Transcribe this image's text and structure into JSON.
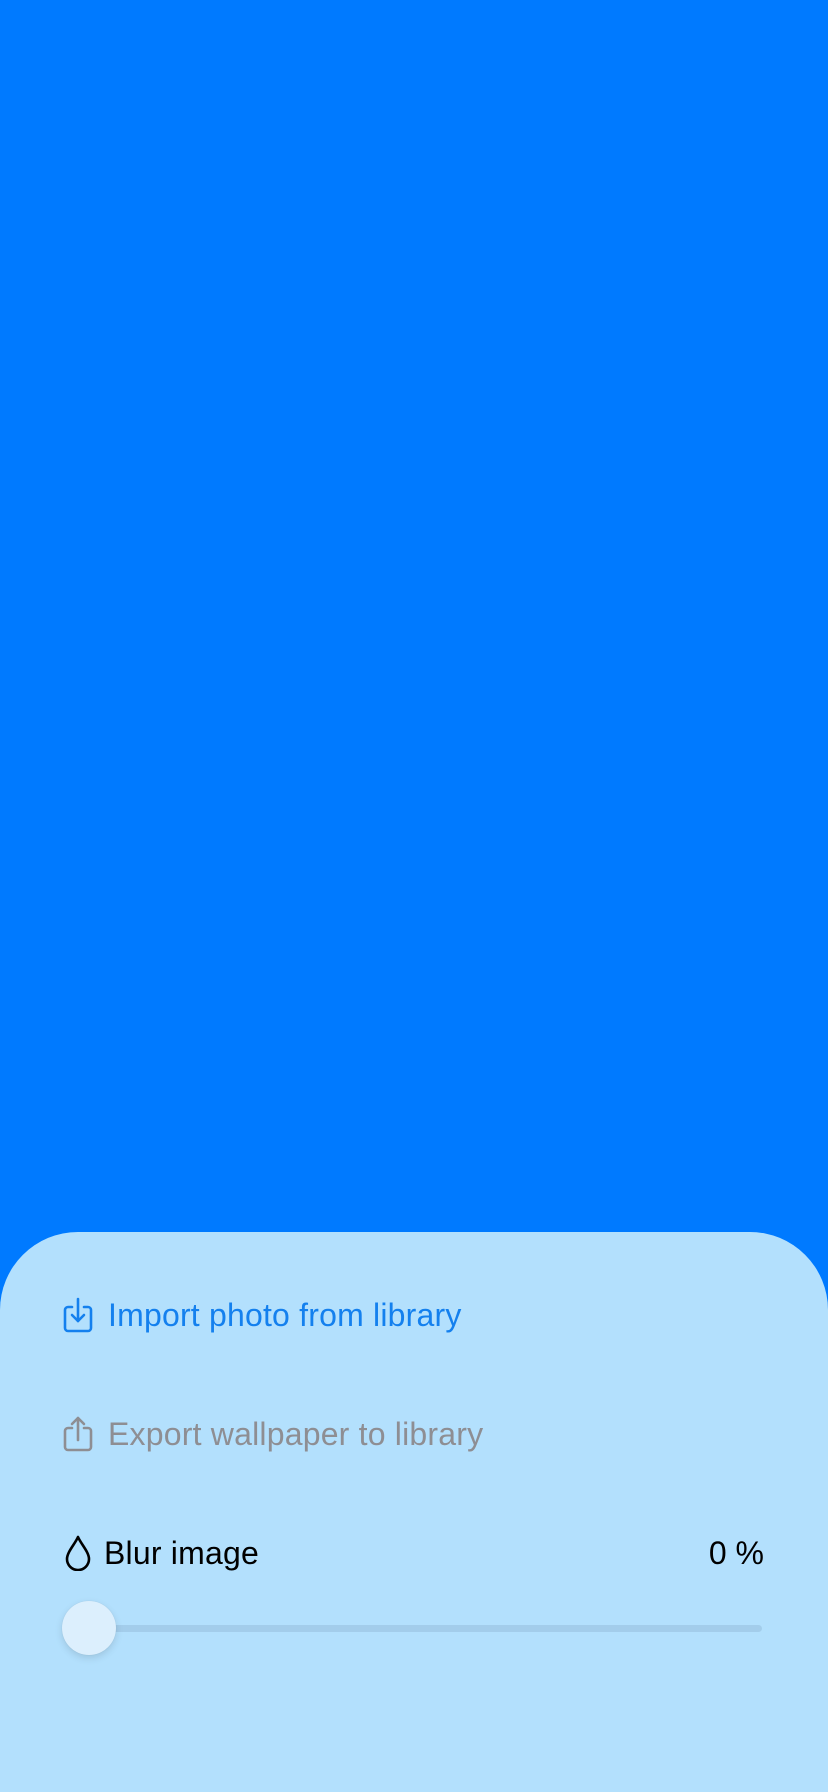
{
  "colors": {
    "wallpaper_background": "#007AFF",
    "sheet_background": "#B3E0FD",
    "accent": "#1480EE",
    "disabled_text": "#8E8E93"
  },
  "wallpaper_preview": {
    "fill_color": "#007AFF"
  },
  "actions": {
    "import": {
      "label": "Import photo from library",
      "icon": "tray-download-icon",
      "enabled": true
    },
    "export": {
      "label": "Export wallpaper to library",
      "icon": "share-export-icon",
      "enabled": false
    }
  },
  "blur": {
    "label": "Blur image",
    "icon": "drop-icon",
    "value_text": "0 %",
    "value": 0,
    "min": 0,
    "max": 100
  }
}
